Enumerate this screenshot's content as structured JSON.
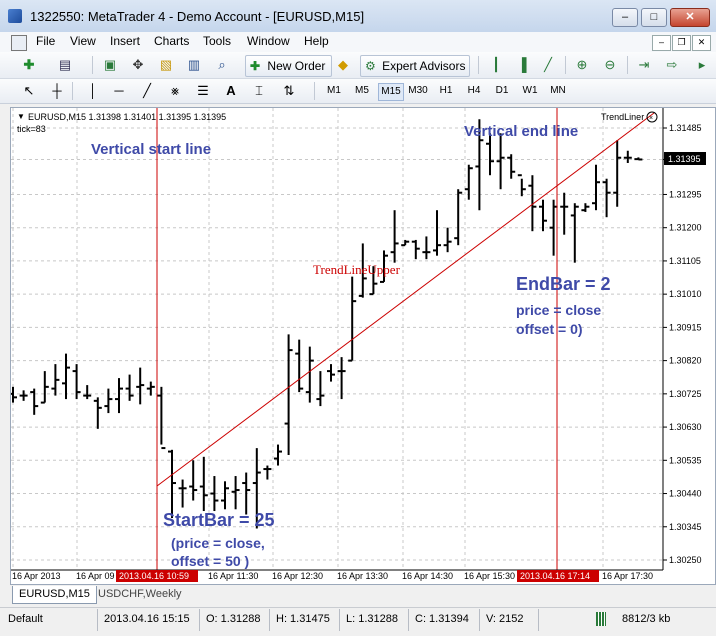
{
  "window": {
    "title": "1322550: MetaTrader 4 - Demo Account - [EURUSD,M15]"
  },
  "menu": [
    {
      "label": "File"
    },
    {
      "label": "View"
    },
    {
      "label": "Insert"
    },
    {
      "label": "Charts"
    },
    {
      "label": "Tools"
    },
    {
      "label": "Window"
    },
    {
      "label": "Help"
    }
  ],
  "toolbar": {
    "new_order": "New Order",
    "expert_advisors": "Expert Advisors",
    "timeframes": [
      "M1",
      "M5",
      "M15",
      "M30",
      "H1",
      "H4",
      "D1",
      "W1",
      "MN"
    ],
    "active_timeframe": "M15"
  },
  "chart": {
    "info_line": "EURUSD,M15  1.31398 1.31401 1.31395 1.31395",
    "tick": "tick=83",
    "indicator_label": "TrendLiner",
    "current_price": "1.31395",
    "price_labels": [
      "1.31485",
      "1.31395",
      "1.31295",
      "1.31200",
      "1.31105",
      "1.31010",
      "1.30915",
      "1.30820",
      "1.30725",
      "1.30630",
      "1.30535",
      "1.30440",
      "1.30345",
      "1.30250"
    ],
    "time_labels": [
      "16 Apr 2013",
      "16 Apr 09",
      "16 Apr 11:30",
      "16 Apr 12:30",
      "16 Apr 13:30",
      "16 Apr 14:30",
      "16 Apr 15:30",
      "16 Apr 17:30"
    ],
    "start_time_marker": "2013.04.16 10:59",
    "end_time_marker": "2013.04.16 17:14",
    "annotations": {
      "vertical_start": "Vertical start line",
      "vertical_end": "Vertical end line",
      "trendline_name": "TrendLineUpper",
      "endbar_title": "EndBar = 2",
      "endbar_line1": "price = close",
      "endbar_line2": "offset = 0)",
      "startbar_title": "StartBar = 25",
      "startbar_line1": "(price = close,",
      "startbar_line2": "offset = 50 )"
    },
    "colors": {
      "annotation_blue": "#3f4aa8",
      "line_red": "#cc0000",
      "bars": "#000000"
    },
    "bars": [
      {
        "o": 1.30725,
        "h": 1.30745,
        "l": 1.307,
        "c": 1.30715
      },
      {
        "o": 1.3072,
        "h": 1.30735,
        "l": 1.30705,
        "c": 1.3072
      },
      {
        "o": 1.3073,
        "h": 1.3074,
        "l": 1.30665,
        "c": 1.3069
      },
      {
        "o": 1.307,
        "h": 1.3079,
        "l": 1.307,
        "c": 1.30745
      },
      {
        "o": 1.3074,
        "h": 1.3081,
        "l": 1.3072,
        "c": 1.30765
      },
      {
        "o": 1.30755,
        "h": 1.3084,
        "l": 1.3071,
        "c": 1.308
      },
      {
        "o": 1.3079,
        "h": 1.3081,
        "l": 1.3071,
        "c": 1.3073
      },
      {
        "o": 1.3072,
        "h": 1.3075,
        "l": 1.3071,
        "c": 1.3072
      },
      {
        "o": 1.30705,
        "h": 1.30715,
        "l": 1.30625,
        "c": 1.30685
      },
      {
        "o": 1.3069,
        "h": 1.3074,
        "l": 1.3067,
        "c": 1.3071
      },
      {
        "o": 1.3071,
        "h": 1.3077,
        "l": 1.3067,
        "c": 1.3074
      },
      {
        "o": 1.3074,
        "h": 1.3078,
        "l": 1.30705,
        "c": 1.3072
      },
      {
        "o": 1.30745,
        "h": 1.308,
        "l": 1.30695,
        "c": 1.3075
      },
      {
        "o": 1.3074,
        "h": 1.3076,
        "l": 1.3072,
        "c": 1.30745
      },
      {
        "o": 1.3072,
        "h": 1.30745,
        "l": 1.3058,
        "c": 1.3057
      },
      {
        "o": 1.3056,
        "h": 1.30565,
        "l": 1.3037,
        "c": 1.3047
      },
      {
        "o": 1.30455,
        "h": 1.3048,
        "l": 1.304,
        "c": 1.30455
      },
      {
        "o": 1.3046,
        "h": 1.30535,
        "l": 1.3042,
        "c": 1.3045
      },
      {
        "o": 1.3046,
        "h": 1.30545,
        "l": 1.3039,
        "c": 1.30435
      },
      {
        "o": 1.3044,
        "h": 1.3049,
        "l": 1.3039,
        "c": 1.3042
      },
      {
        "o": 1.3042,
        "h": 1.30475,
        "l": 1.30395,
        "c": 1.30455
      },
      {
        "o": 1.30445,
        "h": 1.3049,
        "l": 1.30395,
        "c": 1.3045
      },
      {
        "o": 1.3047,
        "h": 1.305,
        "l": 1.3038,
        "c": 1.3045
      },
      {
        "o": 1.3047,
        "h": 1.3057,
        "l": 1.3034,
        "c": 1.305
      },
      {
        "o": 1.3051,
        "h": 1.3052,
        "l": 1.3048,
        "c": 1.3051
      },
      {
        "o": 1.3054,
        "h": 1.3058,
        "l": 1.3052,
        "c": 1.3056
      },
      {
        "o": 1.3064,
        "h": 1.30895,
        "l": 1.3055,
        "c": 1.3085
      },
      {
        "o": 1.3084,
        "h": 1.3088,
        "l": 1.3073,
        "c": 1.3074
      },
      {
        "o": 1.3073,
        "h": 1.3086,
        "l": 1.307,
        "c": 1.3082
      },
      {
        "o": 1.3071,
        "h": 1.3079,
        "l": 1.3069,
        "c": 1.3072
      },
      {
        "o": 1.3079,
        "h": 1.3081,
        "l": 1.3076,
        "c": 1.3078
      },
      {
        "o": 1.3079,
        "h": 1.3083,
        "l": 1.3071,
        "c": 1.3079
      },
      {
        "o": 1.3082,
        "h": 1.3106,
        "l": 1.3082,
        "c": 1.3099
      },
      {
        "o": 1.31005,
        "h": 1.31155,
        "l": 1.31,
        "c": 1.31055
      },
      {
        "o": 1.3101,
        "h": 1.3109,
        "l": 1.3101,
        "c": 1.3104
      },
      {
        "o": 1.31045,
        "h": 1.31135,
        "l": 1.31045,
        "c": 1.3112
      },
      {
        "o": 1.3113,
        "h": 1.3125,
        "l": 1.311,
        "c": 1.31155
      },
      {
        "o": 1.3115,
        "h": 1.31165,
        "l": 1.3115,
        "c": 1.3116
      },
      {
        "o": 1.3116,
        "h": 1.31165,
        "l": 1.3111,
        "c": 1.3114
      },
      {
        "o": 1.3113,
        "h": 1.31175,
        "l": 1.3111,
        "c": 1.3113
      },
      {
        "o": 1.31135,
        "h": 1.3125,
        "l": 1.3112,
        "c": 1.3115
      },
      {
        "o": 1.3115,
        "h": 1.312,
        "l": 1.3113,
        "c": 1.3116
      },
      {
        "o": 1.3117,
        "h": 1.3131,
        "l": 1.3115,
        "c": 1.313
      },
      {
        "o": 1.3131,
        "h": 1.3138,
        "l": 1.3128,
        "c": 1.3137
      },
      {
        "o": 1.31375,
        "h": 1.3151,
        "l": 1.3125,
        "c": 1.3145
      },
      {
        "o": 1.3144,
        "h": 1.3147,
        "l": 1.3135,
        "c": 1.3139
      },
      {
        "o": 1.3139,
        "h": 1.3147,
        "l": 1.3131,
        "c": 1.314
      },
      {
        "o": 1.314,
        "h": 1.3141,
        "l": 1.3134,
        "c": 1.3136
      },
      {
        "o": 1.3135,
        "h": 1.3134,
        "l": 1.3129,
        "c": 1.3131
      },
      {
        "o": 1.3132,
        "h": 1.3135,
        "l": 1.3119,
        "c": 1.3126
      },
      {
        "o": 1.3126,
        "h": 1.3128,
        "l": 1.3119,
        "c": 1.3122
      },
      {
        "o": 1.312,
        "h": 1.3128,
        "l": 1.3112,
        "c": 1.3126
      },
      {
        "o": 1.3126,
        "h": 1.313,
        "l": 1.3118,
        "c": 1.3126
      },
      {
        "o": 1.31235,
        "h": 1.3127,
        "l": 1.311,
        "c": 1.3126
      },
      {
        "o": 1.3125,
        "h": 1.3127,
        "l": 1.31245,
        "c": 1.3126
      },
      {
        "o": 1.3127,
        "h": 1.3138,
        "l": 1.3125,
        "c": 1.3133
      },
      {
        "o": 1.3133,
        "h": 1.3134,
        "l": 1.3123,
        "c": 1.313
      },
      {
        "o": 1.313,
        "h": 1.3145,
        "l": 1.3126,
        "c": 1.314
      },
      {
        "o": 1.314,
        "h": 1.3142,
        "l": 1.31385,
        "c": 1.314
      },
      {
        "o": 1.31396,
        "h": 1.31401,
        "l": 1.31395,
        "c": 1.31395
      }
    ]
  },
  "tabs": [
    {
      "label": "EURUSD,M15"
    },
    {
      "label": "USDCHF,Weekly"
    }
  ],
  "status": {
    "profile": "Default",
    "datetime": "2013.04.16 15:15",
    "open": "O: 1.31288",
    "high": "H: 1.31475",
    "low": "L: 1.31288",
    "close": "C: 1.31394",
    "volume": "V: 2152",
    "traffic": "8812/3 kb"
  }
}
